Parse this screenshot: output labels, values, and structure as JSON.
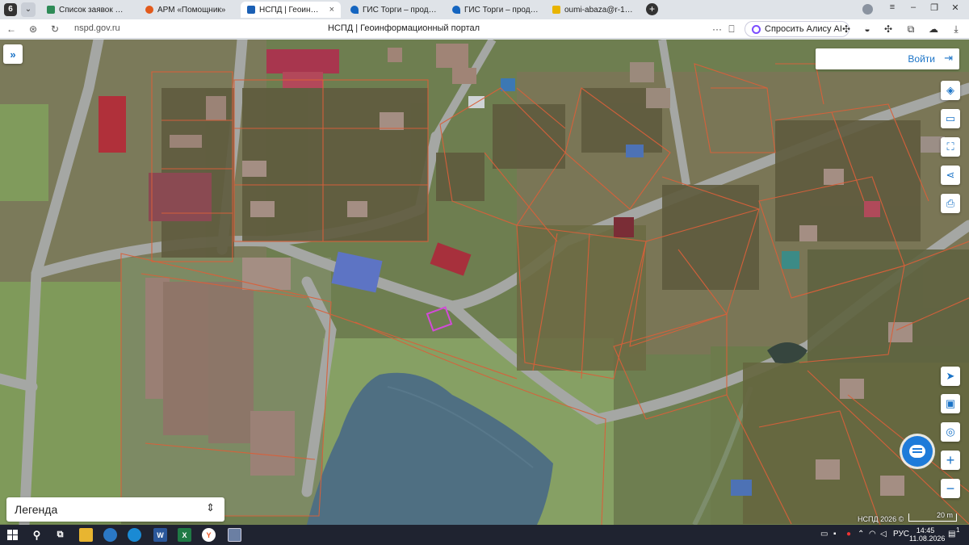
{
  "browser": {
    "logo_label": "6",
    "tabs": [
      {
        "label": "Список заявок — ТехноК",
        "favicon_color": "#2e8b57"
      },
      {
        "label": "АРМ «Помощник»",
        "favicon_color": "#e25a1c"
      },
      {
        "label": "НСПД | Геоинформаци",
        "favicon_color": "#1a5fb4"
      },
      {
        "label": "ГИС Торги – продажи гос",
        "favicon_color": "#1565c0"
      },
      {
        "label": "ГИС Торги – продажи гос",
        "favicon_color": "#1565c0"
      },
      {
        "label": "oumi-abaza@r-19.ru - Спа",
        "favicon_color": "#e8b400"
      }
    ],
    "new_tab": "+",
    "url": "nspd.gov.ru",
    "page_title": "НСПД | Геоинформационный портал",
    "alice_label": "Спросить Алису AI",
    "more": "···"
  },
  "map": {
    "login_label": "Войти",
    "legend_label": "Легенда",
    "copyright": "НСПД 2026 ©",
    "scale_label": "20 m",
    "zoom_in": "+",
    "zoom_out": "−"
  },
  "taskbar": {
    "language": "РУС",
    "time": "14:45",
    "date": "11.08.2026",
    "notification_count": "1"
  }
}
